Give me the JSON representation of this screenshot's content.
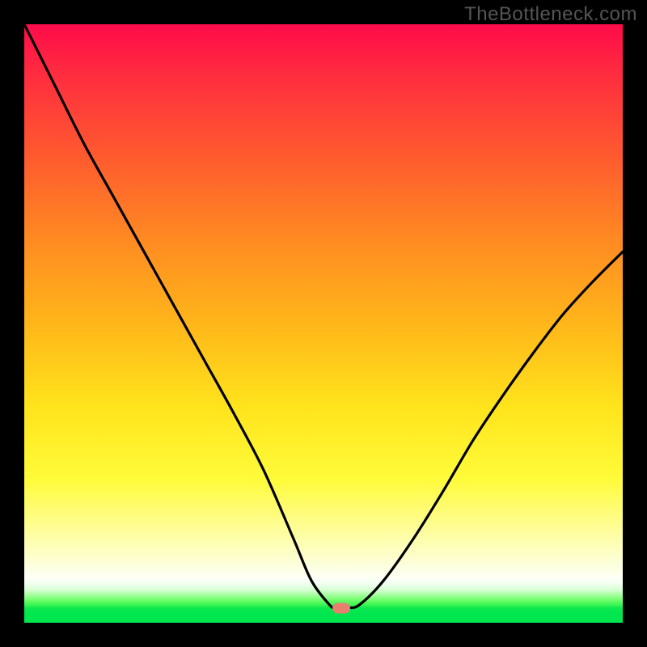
{
  "watermark": "TheBottleneck.com",
  "colors": {
    "frame": "#000000",
    "gradient_top": "#ff0b4a",
    "gradient_mid": "#ffe41c",
    "gradient_bottom": "#00e64f",
    "curve": "#000000",
    "marker": "#e8806f"
  },
  "chart_data": {
    "type": "line",
    "title": "",
    "xlabel": "",
    "ylabel": "",
    "xlim": [
      0,
      100
    ],
    "ylim": [
      0,
      100
    ],
    "series": [
      {
        "name": "bottleneck-curve",
        "x": [
          0,
          5,
          10,
          15,
          20,
          25,
          30,
          35,
          40,
          45,
          48,
          51,
          52,
          54,
          56,
          60,
          65,
          70,
          75,
          80,
          85,
          90,
          95,
          100
        ],
        "values": [
          100,
          90,
          80,
          71,
          62,
          53,
          44,
          35,
          25.5,
          14,
          7,
          3,
          2.5,
          2.5,
          3,
          7,
          14,
          22,
          30.5,
          38,
          45,
          51.5,
          57,
          62
        ]
      }
    ],
    "annotations": [
      {
        "name": "optimal-marker",
        "x": 53,
        "y": 2.5,
        "shape": "rounded-pill",
        "color": "#e8806f"
      }
    ],
    "background": {
      "type": "vertical-gradient",
      "meaning": "red=high bottleneck, green=low bottleneck",
      "stops": [
        {
          "pos": 0.0,
          "color": "#ff0b4a"
        },
        {
          "pos": 0.5,
          "color": "#ffb61a"
        },
        {
          "pos": 0.76,
          "color": "#fffb3a"
        },
        {
          "pos": 0.97,
          "color": "#00e64f"
        },
        {
          "pos": 1.0,
          "color": "#00e64f"
        }
      ]
    }
  }
}
